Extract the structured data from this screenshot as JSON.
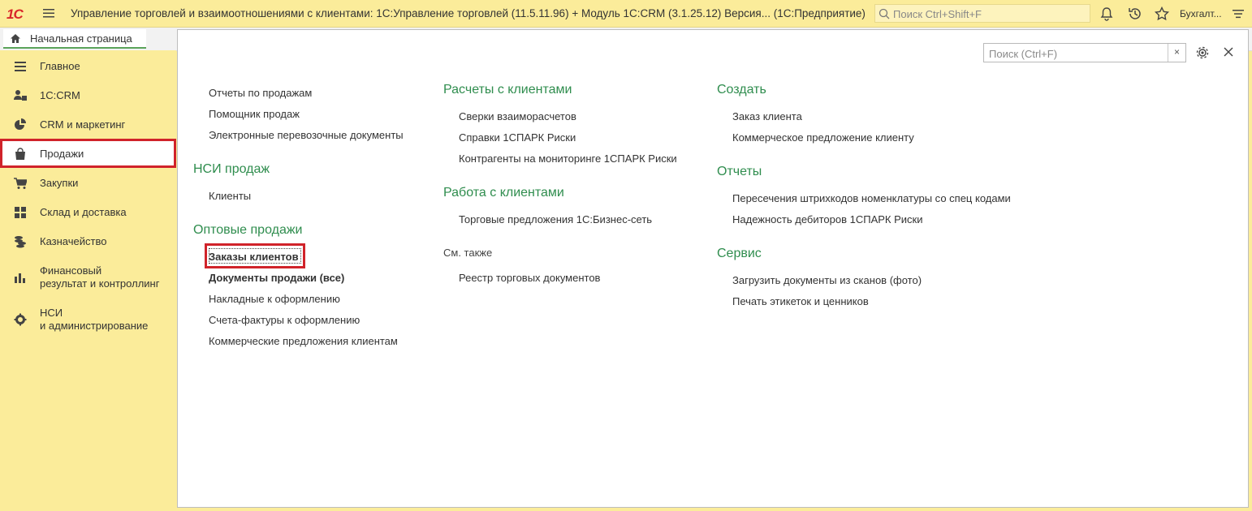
{
  "app": {
    "logo": "1С",
    "title": "Управление торговлей и взаимоотношениями с клиентами: 1С:Управление торговлей (11.5.11.96) + Модуль 1С:CRM (3.1.25.12) Версия...  (1С:Предприятие)",
    "search_placeholder": "Поиск Ctrl+Shift+F",
    "user": "Бухгалт..."
  },
  "tabs": {
    "home_label": "Начальная страница"
  },
  "sidebar": {
    "items": [
      {
        "label": "Главное",
        "icon": "list-icon"
      },
      {
        "label": "1С:CRM",
        "icon": "users-icon"
      },
      {
        "label": "CRM и маркетинг",
        "icon": "pie-chart-icon"
      },
      {
        "label": "Продажи",
        "icon": "shopping-bag-icon",
        "active": true
      },
      {
        "label": "Закупки",
        "icon": "cart-icon"
      },
      {
        "label": "Склад и доставка",
        "icon": "grid-icon"
      },
      {
        "label": "Казначейство",
        "icon": "coins-icon"
      },
      {
        "label1": "Финансовый",
        "label2": "результат и контроллинг",
        "icon": "bar-chart-icon"
      },
      {
        "label1": "НСИ",
        "label2": "и администрирование",
        "icon": "gear-icon"
      }
    ]
  },
  "main": {
    "filter_placeholder": "Поиск (Ctrl+F)",
    "filter_clear": "×",
    "col1": {
      "top_links": [
        "Отчеты по продажам",
        "Помощник продаж",
        "Электронные перевозочные документы"
      ],
      "nsi_head": "НСИ продаж",
      "nsi_links": [
        "Клиенты"
      ],
      "wholesale_head": "Оптовые продажи",
      "wholesale_links": [
        "Заказы клиентов",
        "Документы продажи (все)",
        "Накладные к оформлению",
        "Счета-фактуры к оформлению",
        "Коммерческие предложения клиентам"
      ]
    },
    "col2": {
      "settlements_head": "Расчеты с клиентами",
      "settlements_links": [
        "Сверки взаиморасчетов",
        "Справки 1СПАРК Риски",
        "Контрагенты на мониторинге 1СПАРК Риски"
      ],
      "work_head": "Работа с клиентами",
      "work_links": [
        "Торговые предложения 1С:Бизнес-сеть"
      ],
      "see_also": "См. также",
      "see_also_links": [
        "Реестр торговых документов"
      ]
    },
    "col3": {
      "create_head": "Создать",
      "create_links": [
        "Заказ клиента",
        "Коммерческое предложение клиенту"
      ],
      "reports_head": "Отчеты",
      "reports_links": [
        "Пересечения штрихкодов номенклатуры со спец кодами",
        "Надежность дебиторов 1СПАРК Риски"
      ],
      "service_head": "Сервис",
      "service_links": [
        "Загрузить документы из сканов (фото)",
        "Печать этикеток и ценников"
      ]
    }
  },
  "colors": {
    "accent_green": "#2f8d4e",
    "highlight_red": "#d0232a",
    "panel_yellow": "#fbec9a"
  }
}
